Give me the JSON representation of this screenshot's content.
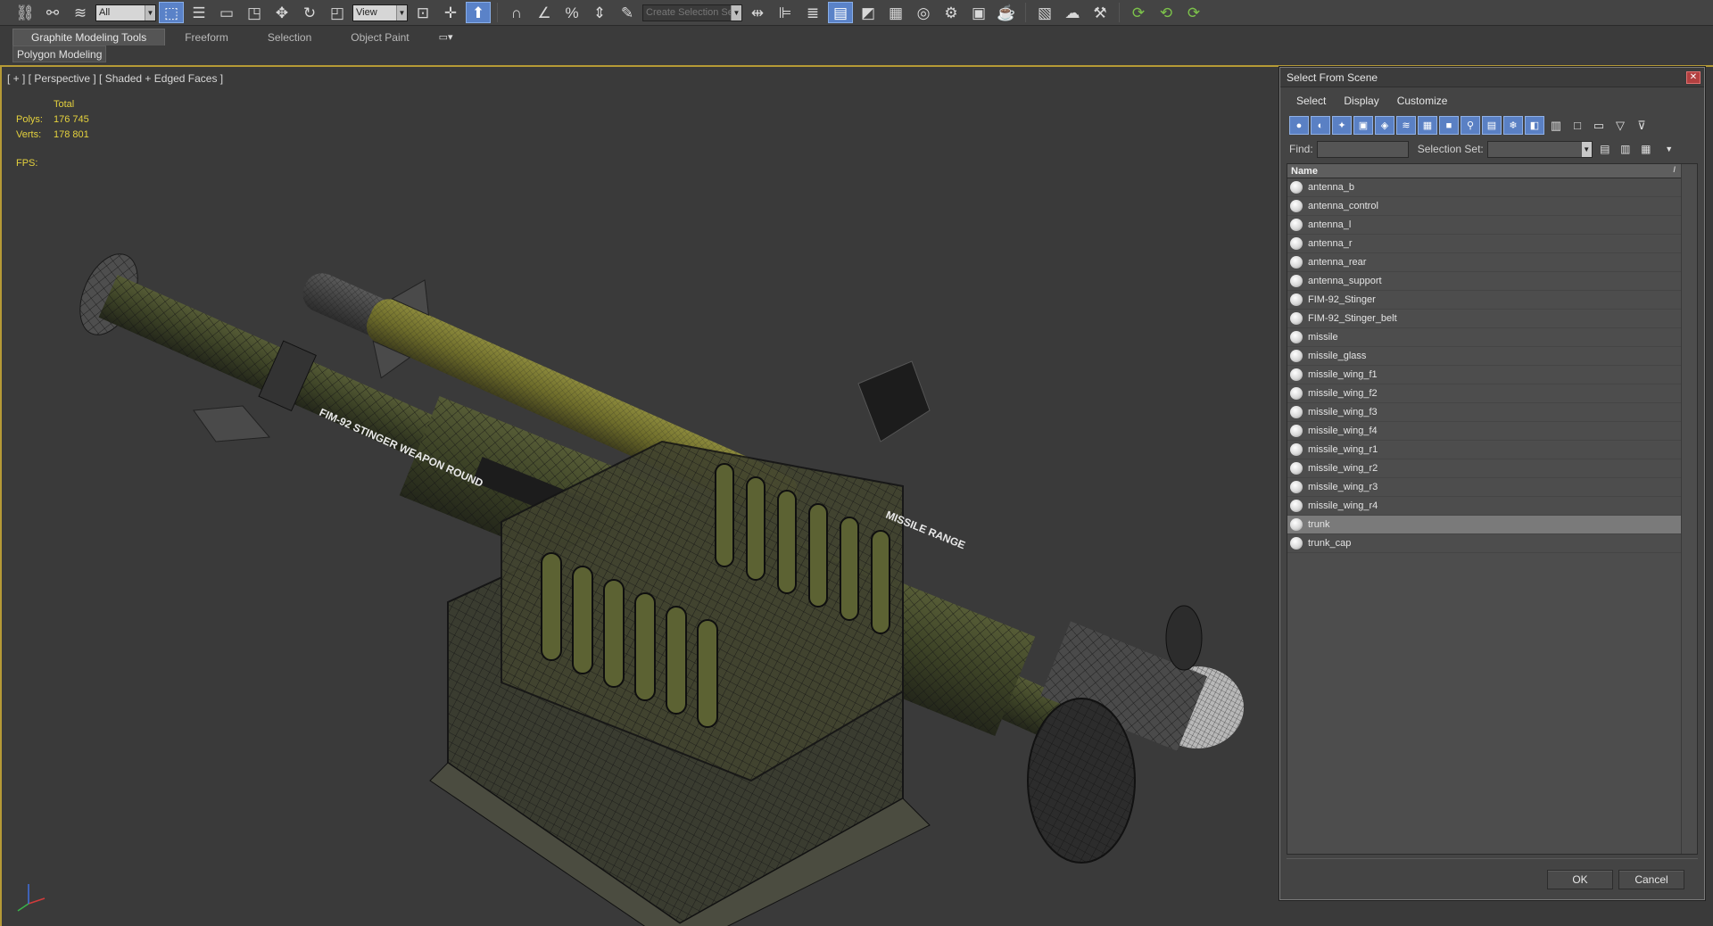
{
  "toolbar": {
    "filter_value": "All",
    "ref_coord_value": "View",
    "selection_set_placeholder": "Create Selection Se"
  },
  "ribbon": {
    "tabs": [
      "Graphite Modeling Tools",
      "Freeform",
      "Selection",
      "Object Paint"
    ],
    "active_tab": "Graphite Modeling Tools",
    "sub_panel": "Polygon Modeling"
  },
  "viewport": {
    "label": "[ + ] [ Perspective ] [ Shaded + Edged Faces ]",
    "stats": {
      "header": "Total",
      "polys_label": "Polys:",
      "polys_value": "176 745",
      "verts_label": "Verts:",
      "verts_value": "178 801",
      "fps_label": "FPS:"
    }
  },
  "dialog": {
    "title": "Select From Scene",
    "close_icon": "✕",
    "menu": [
      "Select",
      "Display",
      "Customize"
    ],
    "find_label": "Find:",
    "find_value": "",
    "selection_set_label": "Selection Set:",
    "column_name": "Name",
    "items": [
      {
        "name": "antenna_b",
        "selected": false
      },
      {
        "name": "antenna_control",
        "selected": false
      },
      {
        "name": "antenna_l",
        "selected": false
      },
      {
        "name": "antenna_r",
        "selected": false
      },
      {
        "name": "antenna_rear",
        "selected": false
      },
      {
        "name": "antenna_support",
        "selected": false
      },
      {
        "name": "FIM-92_Stinger",
        "selected": false
      },
      {
        "name": "FIM-92_Stinger_belt",
        "selected": false
      },
      {
        "name": "missile",
        "selected": false
      },
      {
        "name": "missile_glass",
        "selected": false
      },
      {
        "name": "missile_wing_f1",
        "selected": false
      },
      {
        "name": "missile_wing_f2",
        "selected": false
      },
      {
        "name": "missile_wing_f3",
        "selected": false
      },
      {
        "name": "missile_wing_f4",
        "selected": false
      },
      {
        "name": "missile_wing_r1",
        "selected": false
      },
      {
        "name": "missile_wing_r2",
        "selected": false
      },
      {
        "name": "missile_wing_r3",
        "selected": false
      },
      {
        "name": "missile_wing_r4",
        "selected": false
      },
      {
        "name": "trunk",
        "selected": true
      },
      {
        "name": "trunk_cap",
        "selected": false
      }
    ],
    "ok_label": "OK",
    "cancel_label": "Cancel"
  },
  "colors": {
    "viewport_border": "#b59a36",
    "stats_text": "#e5d23d",
    "accent_blue": "#5a80c4",
    "selected_row": "#7a7a7a"
  }
}
